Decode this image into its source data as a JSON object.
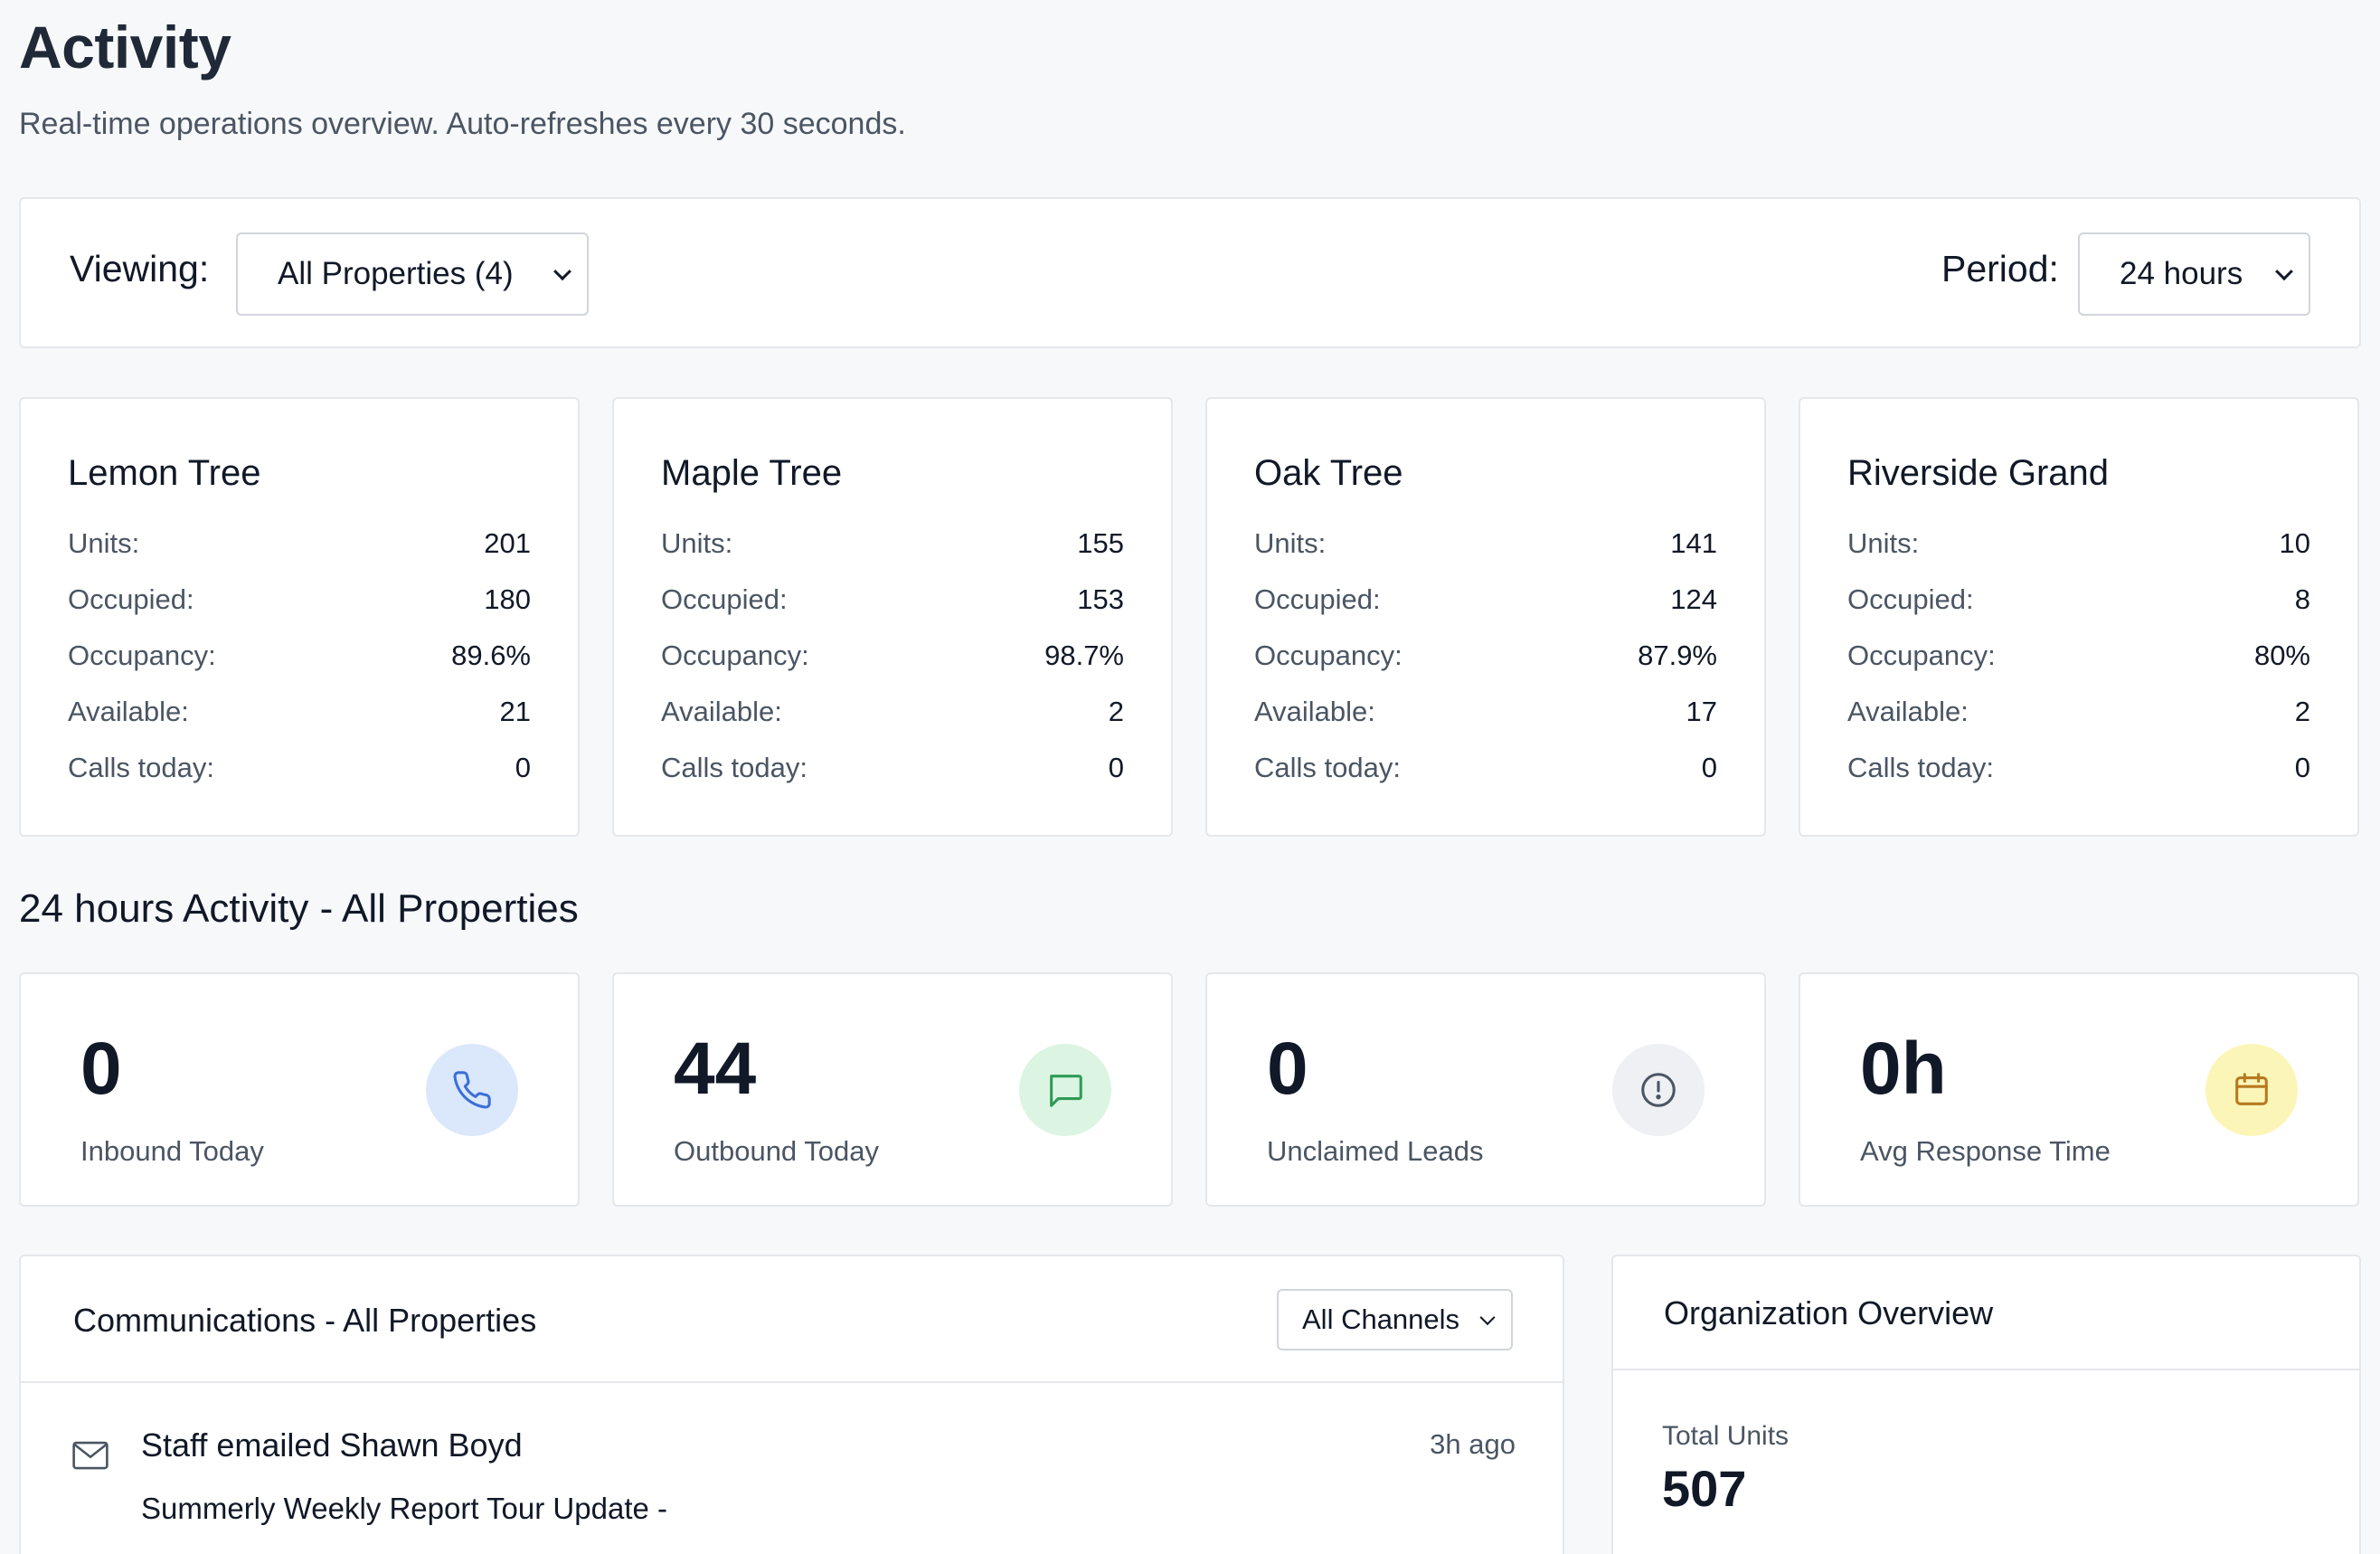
{
  "header": {
    "title": "Activity",
    "subtitle": "Real-time operations overview. Auto-refreshes every 30 seconds."
  },
  "filters": {
    "viewing_label": "Viewing:",
    "viewing_value": "All Properties (4)",
    "period_label": "Period:",
    "period_value": "24 hours"
  },
  "properties": [
    {
      "name": "Lemon Tree",
      "units": "201",
      "occupied": "180",
      "occupancy": "89.6%",
      "available": "21",
      "calls_today": "0"
    },
    {
      "name": "Maple Tree",
      "units": "155",
      "occupied": "153",
      "occupancy": "98.7%",
      "available": "2",
      "calls_today": "0"
    },
    {
      "name": "Oak Tree",
      "units": "141",
      "occupied": "124",
      "occupancy": "87.9%",
      "available": "17",
      "calls_today": "0"
    },
    {
      "name": "Riverside Grand",
      "units": "10",
      "occupied": "8",
      "occupancy": "80%",
      "available": "2",
      "calls_today": "0"
    }
  ],
  "property_labels": {
    "units": "Units:",
    "occupied": "Occupied:",
    "occupancy": "Occupancy:",
    "available": "Available:",
    "calls_today": "Calls today:"
  },
  "activity": {
    "title": "24 hours Activity - All Properties",
    "stats": [
      {
        "value": "0",
        "label": "Inbound Today",
        "icon": "phone-icon",
        "icon_bg": "#dbe8fb",
        "icon_color": "#3b6fd8"
      },
      {
        "value": "44",
        "label": "Outbound Today",
        "icon": "message-icon",
        "icon_bg": "#dcf5e3",
        "icon_color": "#2f9a57"
      },
      {
        "value": "0",
        "label": "Unclaimed Leads",
        "icon": "alert-circle-icon",
        "icon_bg": "#eef0f3",
        "icon_color": "#4b5563"
      },
      {
        "value": "0h",
        "label": "Avg Response Time",
        "icon": "calendar-icon",
        "icon_bg": "#fbf6b8",
        "icon_color": "#b7791f"
      }
    ]
  },
  "communications": {
    "title": "Communications - All Properties",
    "channel_filter": "All Channels",
    "items": [
      {
        "title": "Staff emailed Shawn Boyd",
        "time": "3h ago",
        "subject": "Summerly Weekly Report Tour Update -",
        "icon": "mail-icon"
      }
    ]
  },
  "organization": {
    "title": "Organization Overview",
    "total_units_label": "Total Units",
    "total_units_value": "507"
  }
}
